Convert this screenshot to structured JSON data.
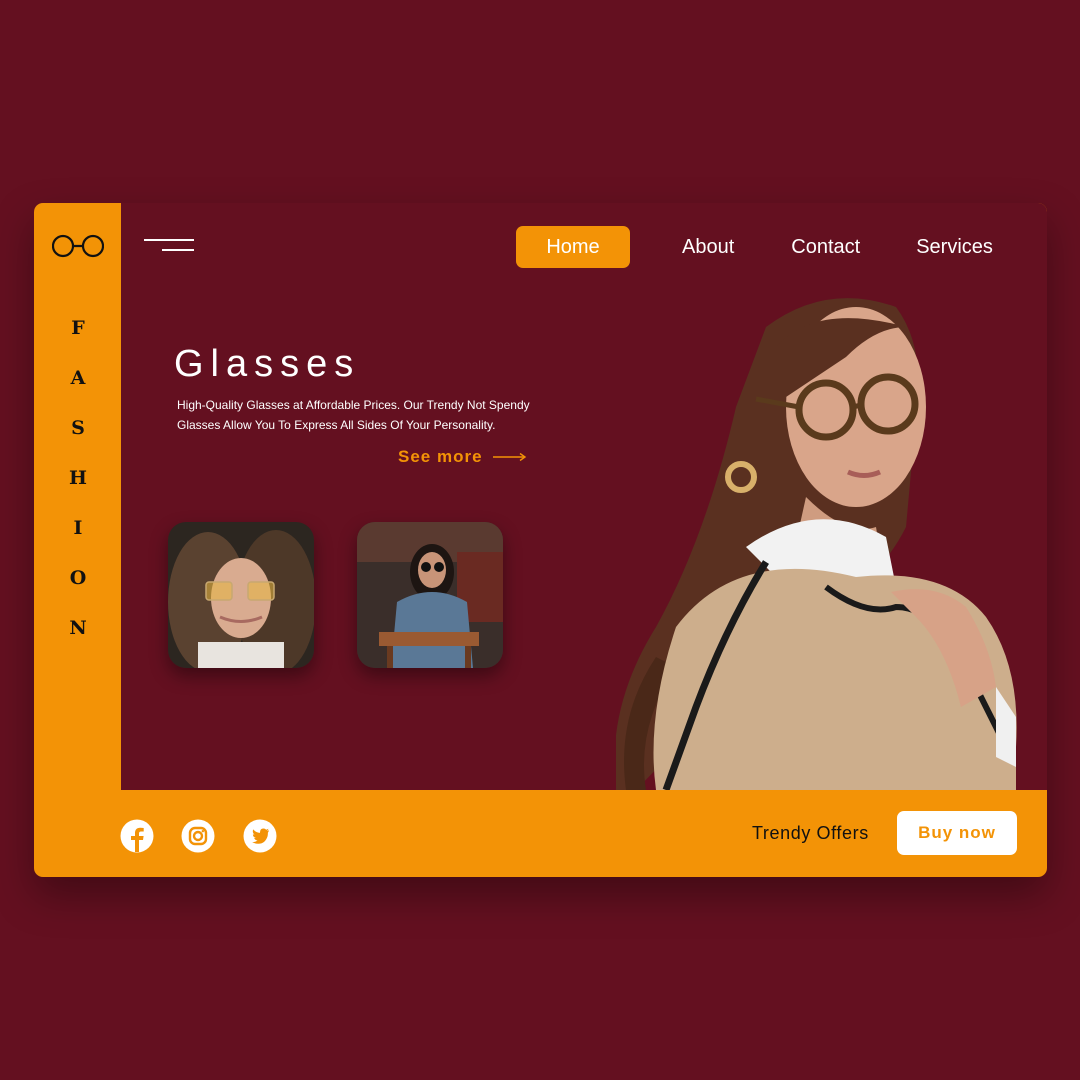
{
  "brand": {
    "vertical_letters": [
      "F",
      "A",
      "S",
      "H",
      "I",
      "O",
      "N"
    ],
    "logo_icon": "glasses-icon"
  },
  "nav": {
    "items": [
      {
        "label": "Home",
        "active": true
      },
      {
        "label": "About"
      },
      {
        "label": "Contact"
      },
      {
        "label": "Services"
      }
    ]
  },
  "hero": {
    "title": "Glasses",
    "description": "High-Quality Glasses at Affordable Prices. Our Trendy Not Spendy Glasses Allow You To Express All Sides Of Your Personality.",
    "cta_label": "See more"
  },
  "footer": {
    "social_icons": [
      "facebook-icon",
      "instagram-icon",
      "twitter-icon"
    ],
    "offers_label": "Trendy Offers",
    "buy_label": "Buy now"
  },
  "colors": {
    "background": "#641020",
    "accent": "#f39306",
    "white": "#ffffff",
    "text_dark": "#111111"
  }
}
